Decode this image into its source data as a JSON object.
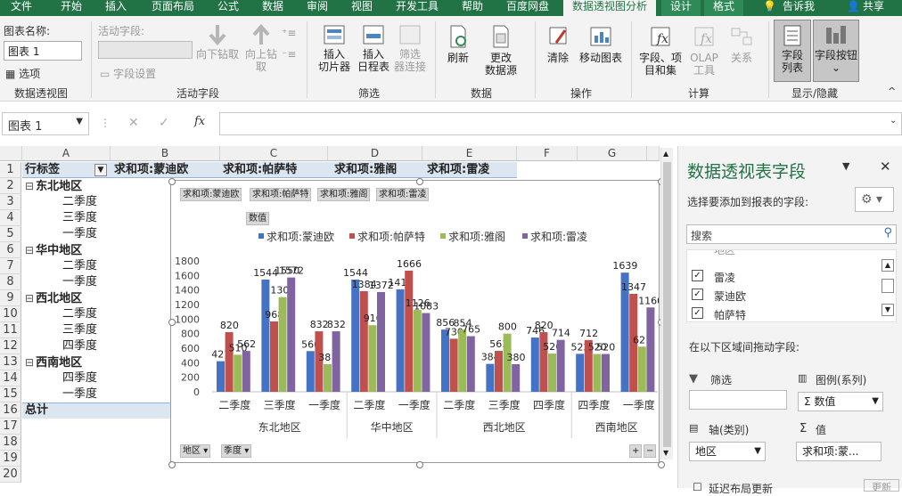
{
  "tabs": [
    "文件",
    "开始",
    "插入",
    "页面布局",
    "公式",
    "数据",
    "审阅",
    "视图",
    "开发工具",
    "帮助",
    "百度网盘",
    "数据透视图分析",
    "设计",
    "格式",
    "告诉我",
    "共享"
  ],
  "ribbon": {
    "chart_name_label": "图表名称:",
    "chart_name_value": "图表 1",
    "options": "选项",
    "g1": "数据透视图",
    "active_field_label": "活动字段:",
    "field_settings": "字段设置",
    "drill_down": "向下钻取",
    "drill_up_1": "向上钻",
    "drill_up_2": "取",
    "g2": "活动字段",
    "slicer_1": "插入",
    "slicer_2": "切片器",
    "timeline_1": "插入",
    "timeline_2": "日程表",
    "filterconn_1": "筛选",
    "filterconn_2": "器连接",
    "g3": "筛选",
    "refresh": "刷新",
    "changesrc_1": "更改",
    "changesrc_2": "数据源",
    "g4": "数据",
    "clear": "清除",
    "move": "移动图表",
    "g5": "操作",
    "fields_1": "字段、项",
    "fields_2": "目和集",
    "olap_1": "OLAP",
    "olap_2": "工具",
    "relations": "关系",
    "g6": "计算",
    "fieldlist_1": "字段",
    "fieldlist_2": "列表",
    "fieldbtn": "字段按钮",
    "g7": "显示/隐藏"
  },
  "formula": {
    "name_box": "图表 1",
    "fx": "fx"
  },
  "sheet": {
    "cols": [
      "A",
      "B",
      "C",
      "D",
      "E",
      "F",
      "G"
    ],
    "header": [
      "行标签",
      "求和项:蒙迪欧",
      "求和项:帕萨特",
      "求和项:雅阁",
      "求和项:雷凌"
    ],
    "rows": [
      "东北地区",
      "二季度",
      "三季度",
      "一季度",
      "华中地区",
      "二季度",
      "一季度",
      "西北地区",
      "二季度",
      "三季度",
      "四季度",
      "西南地区",
      "四季度",
      "一季度",
      "总计",
      "",
      "",
      "",
      "",
      ""
    ]
  },
  "chart_buttons": {
    "f1": "求和项:蒙迪欧",
    "f2": "求和项:帕萨特",
    "f3": "求和项:雅阁",
    "f4": "求和项:雷凌",
    "values": "数值",
    "area": "地区",
    "quarter": "季度"
  },
  "chart_data": {
    "type": "bar",
    "categories": [
      "二季度",
      "三季度",
      "一季度",
      "二季度",
      "一季度",
      "二季度",
      "三季度",
      "四季度",
      "四季度",
      "一季度"
    ],
    "groups": [
      {
        "name": "东北地区",
        "count": 3
      },
      {
        "name": "华中地区",
        "count": 2
      },
      {
        "name": "西北地区",
        "count": 3
      },
      {
        "name": "西南地区",
        "count": 2
      }
    ],
    "series": [
      {
        "name": "求和项:蒙迪欧",
        "color": "#4472c4",
        "values": [
          421,
          1544,
          560,
          1544,
          1410,
          856,
          384,
          746,
          522,
          1639
        ]
      },
      {
        "name": "求和项:帕萨特",
        "color": "#c0504d",
        "values": [
          820,
          968,
          832,
          1384,
          1666,
          730,
          563,
          820,
          712,
          1347
        ]
      },
      {
        "name": "求和项:雅阁",
        "color": "#9bbb59",
        "values": [
          510,
          1302,
          381,
          916,
          1126,
          854,
          800,
          526,
          520,
          621
        ]
      },
      {
        "name": "求和项:雷凌",
        "color": "#8064a2",
        "values": [
          562,
          1572,
          832,
          1372,
          1083,
          765,
          380,
          714,
          520,
          1160
        ]
      }
    ],
    "labels": [
      [
        "421",
        "1544",
        "560",
        "1544",
        "1410",
        "856",
        "384",
        "746",
        "522",
        "1639"
      ],
      [
        "820",
        "968",
        "832",
        "1384",
        "1666",
        "730",
        "563",
        "820",
        "712",
        "1347"
      ],
      [
        "510",
        "1302",
        "381",
        "916",
        "1126",
        "854",
        "800",
        "526",
        "520",
        "621"
      ],
      [
        "562",
        "1572",
        "832",
        "1372",
        "1083",
        "765",
        "380",
        "714",
        "520",
        "1160"
      ]
    ],
    "extra_label": "1550",
    "yticks": [
      0,
      200,
      400,
      600,
      800,
      1000,
      1200,
      1400,
      1600,
      1800
    ],
    "ylim": [
      0,
      1800
    ]
  },
  "panel": {
    "title": "数据透视表字段",
    "subtitle": "选择要添加到报表的字段:",
    "search": "搜索",
    "fields": [
      "地区",
      "雷凌",
      "蒙迪欧",
      "帕萨特"
    ],
    "drag": "在以下区域间拖动字段:",
    "filter": "筛选",
    "legend": "图例(系列)",
    "legend_val": "Σ 数值",
    "axis": "轴(类别)",
    "axis_val": "地区",
    "values": "值",
    "values_val": "求和项:蒙...",
    "defer": "延迟布局更新",
    "update": "更新"
  }
}
